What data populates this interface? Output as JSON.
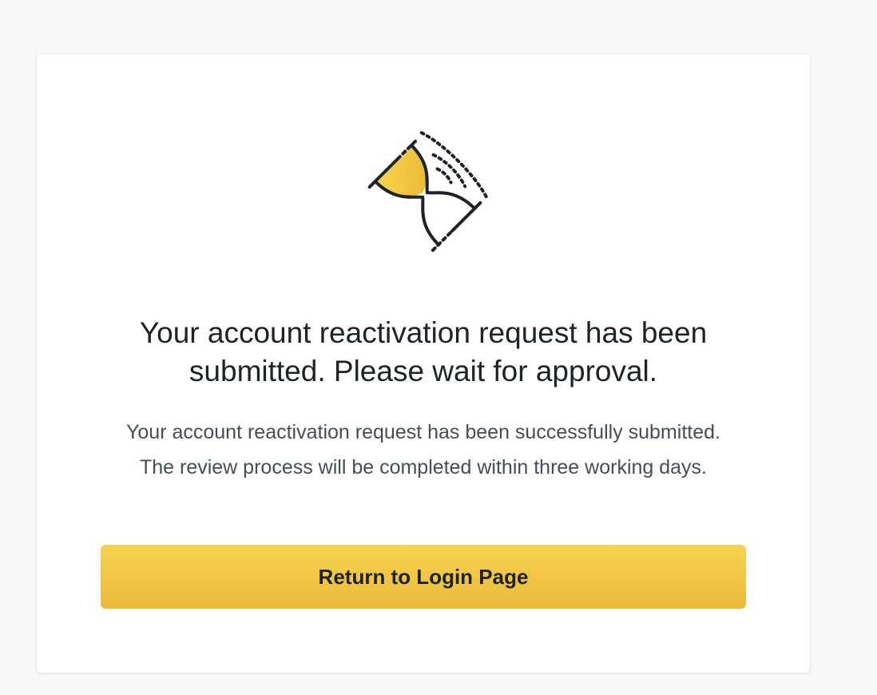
{
  "status_card": {
    "illustration_icon": "hourglass-icon",
    "title": "Your account reactivation request has been submitted. Please wait for approval.",
    "message": "Your account reactivation request has been successfully submitted. The review process will be completed within three working days.",
    "return_button_label": "Return to Login Page"
  },
  "colors": {
    "background": "#f8f8f8",
    "card": "#ffffff",
    "title_text": "#1e2329",
    "body_text": "#474d57",
    "accent_top": "#f5d44f",
    "accent_bottom": "#ecb93a",
    "icon_stroke": "#1e2329"
  }
}
